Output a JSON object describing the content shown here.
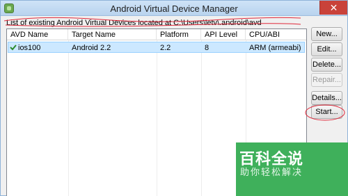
{
  "window": {
    "title": "Android Virtual Device Manager",
    "close_glyph": "✕"
  },
  "caption": "List of existing Android Virtual Devices located at C:\\Users\\letv\\.android\\avd",
  "table": {
    "columns": [
      "AVD Name",
      "Target Name",
      "Platform",
      "API Level",
      "CPU/ABI"
    ],
    "rows": [
      {
        "avd_name": "ios100",
        "target_name": "Android 2.2",
        "platform": "2.2",
        "api_level": "8",
        "cpu_abi": "ARM (armeabi)",
        "status_icon": "check-icon",
        "selected": true
      }
    ]
  },
  "buttons": {
    "new": "New...",
    "edit": "Edit...",
    "delete": "Delete...",
    "repair": "Repair...",
    "details": "Details...",
    "start": "Start..."
  },
  "watermark": {
    "main": "百科全说",
    "sub": "助你轻松解决"
  },
  "colors": {
    "selection": "#cce8ff",
    "annotation": "#e0283a",
    "watermark": "#3fb05b"
  }
}
